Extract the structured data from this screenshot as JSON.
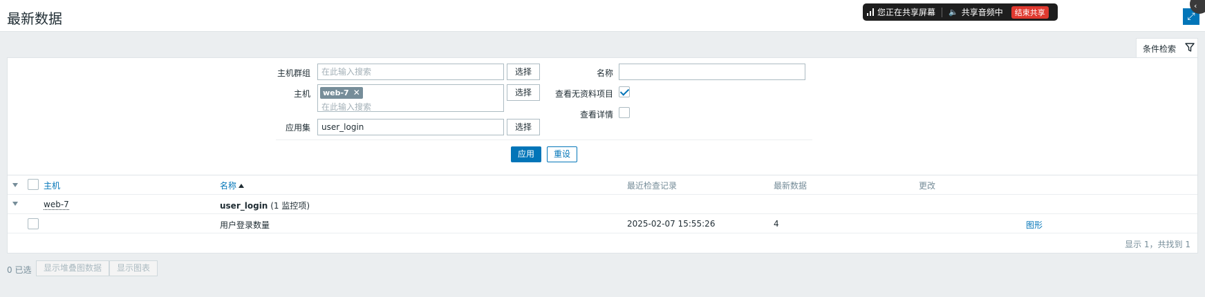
{
  "header": {
    "title": "最新数据"
  },
  "share_bar": {
    "sharing_screen": "您正在共享屏幕",
    "sharing_audio": "共享音频中",
    "stop_label": "结束共享"
  },
  "filter_tab": {
    "label": "条件检索"
  },
  "filter": {
    "host_group": {
      "label": "主机群组",
      "placeholder": "在此输入搜索",
      "select_label": "选择"
    },
    "host": {
      "label": "主机",
      "tag": "web-7",
      "placeholder": "在此输入搜索",
      "select_label": "选择"
    },
    "application": {
      "label": "应用集",
      "value": "user_login",
      "select_label": "选择"
    },
    "name": {
      "label": "名称",
      "value": ""
    },
    "show_no_data": {
      "label": "查看无资料项目",
      "checked": true
    },
    "show_details": {
      "label": "查看详情",
      "checked": false
    },
    "apply_label": "应用",
    "reset_label": "重设"
  },
  "table": {
    "columns": {
      "host": "主机",
      "name": "名称",
      "last_check": "最近检查记录",
      "last_value": "最新数据",
      "change": "更改"
    },
    "group_row": {
      "host": "web-7",
      "app_name": "user_login",
      "count": "(1 监控项)"
    },
    "items": [
      {
        "name": "用户登录数量",
        "last_check": "2025-02-07 15:55:26",
        "last_value": "4",
        "change": "",
        "action": "图形"
      }
    ],
    "footer": "显示 1，共找到 1"
  },
  "bottom": {
    "selected": "0 已选",
    "stacked_graph_label": "显示堆叠图数据",
    "graph_label": "显示图表"
  },
  "colors": {
    "accent": "#0275b8",
    "background": "#ebeef0",
    "share_stop": "#e0392f"
  }
}
